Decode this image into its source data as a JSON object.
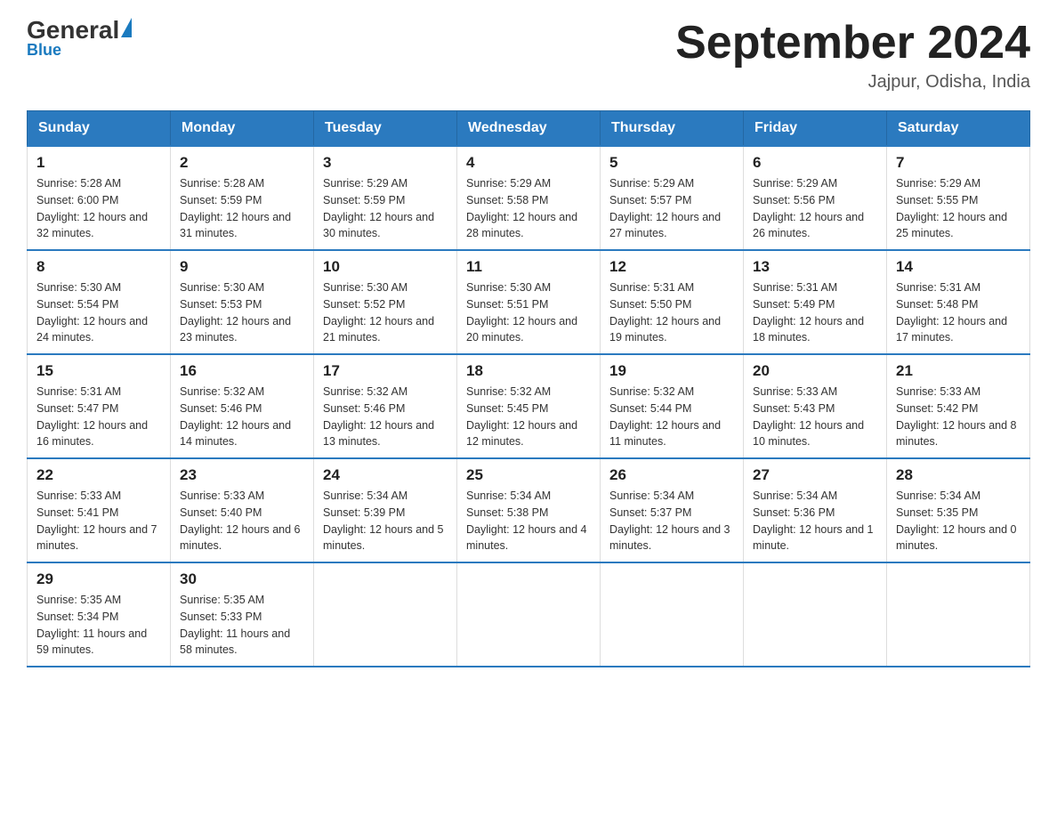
{
  "header": {
    "logo_general": "General",
    "logo_blue": "Blue",
    "month_title": "September 2024",
    "location": "Jajpur, Odisha, India"
  },
  "weekdays": [
    "Sunday",
    "Monday",
    "Tuesday",
    "Wednesday",
    "Thursday",
    "Friday",
    "Saturday"
  ],
  "weeks": [
    [
      {
        "day": "1",
        "sunrise": "5:28 AM",
        "sunset": "6:00 PM",
        "daylight": "12 hours and 32 minutes."
      },
      {
        "day": "2",
        "sunrise": "5:28 AM",
        "sunset": "5:59 PM",
        "daylight": "12 hours and 31 minutes."
      },
      {
        "day": "3",
        "sunrise": "5:29 AM",
        "sunset": "5:59 PM",
        "daylight": "12 hours and 30 minutes."
      },
      {
        "day": "4",
        "sunrise": "5:29 AM",
        "sunset": "5:58 PM",
        "daylight": "12 hours and 28 minutes."
      },
      {
        "day": "5",
        "sunrise": "5:29 AM",
        "sunset": "5:57 PM",
        "daylight": "12 hours and 27 minutes."
      },
      {
        "day": "6",
        "sunrise": "5:29 AM",
        "sunset": "5:56 PM",
        "daylight": "12 hours and 26 minutes."
      },
      {
        "day": "7",
        "sunrise": "5:29 AM",
        "sunset": "5:55 PM",
        "daylight": "12 hours and 25 minutes."
      }
    ],
    [
      {
        "day": "8",
        "sunrise": "5:30 AM",
        "sunset": "5:54 PM",
        "daylight": "12 hours and 24 minutes."
      },
      {
        "day": "9",
        "sunrise": "5:30 AM",
        "sunset": "5:53 PM",
        "daylight": "12 hours and 23 minutes."
      },
      {
        "day": "10",
        "sunrise": "5:30 AM",
        "sunset": "5:52 PM",
        "daylight": "12 hours and 21 minutes."
      },
      {
        "day": "11",
        "sunrise": "5:30 AM",
        "sunset": "5:51 PM",
        "daylight": "12 hours and 20 minutes."
      },
      {
        "day": "12",
        "sunrise": "5:31 AM",
        "sunset": "5:50 PM",
        "daylight": "12 hours and 19 minutes."
      },
      {
        "day": "13",
        "sunrise": "5:31 AM",
        "sunset": "5:49 PM",
        "daylight": "12 hours and 18 minutes."
      },
      {
        "day": "14",
        "sunrise": "5:31 AM",
        "sunset": "5:48 PM",
        "daylight": "12 hours and 17 minutes."
      }
    ],
    [
      {
        "day": "15",
        "sunrise": "5:31 AM",
        "sunset": "5:47 PM",
        "daylight": "12 hours and 16 minutes."
      },
      {
        "day": "16",
        "sunrise": "5:32 AM",
        "sunset": "5:46 PM",
        "daylight": "12 hours and 14 minutes."
      },
      {
        "day": "17",
        "sunrise": "5:32 AM",
        "sunset": "5:46 PM",
        "daylight": "12 hours and 13 minutes."
      },
      {
        "day": "18",
        "sunrise": "5:32 AM",
        "sunset": "5:45 PM",
        "daylight": "12 hours and 12 minutes."
      },
      {
        "day": "19",
        "sunrise": "5:32 AM",
        "sunset": "5:44 PM",
        "daylight": "12 hours and 11 minutes."
      },
      {
        "day": "20",
        "sunrise": "5:33 AM",
        "sunset": "5:43 PM",
        "daylight": "12 hours and 10 minutes."
      },
      {
        "day": "21",
        "sunrise": "5:33 AM",
        "sunset": "5:42 PM",
        "daylight": "12 hours and 8 minutes."
      }
    ],
    [
      {
        "day": "22",
        "sunrise": "5:33 AM",
        "sunset": "5:41 PM",
        "daylight": "12 hours and 7 minutes."
      },
      {
        "day": "23",
        "sunrise": "5:33 AM",
        "sunset": "5:40 PM",
        "daylight": "12 hours and 6 minutes."
      },
      {
        "day": "24",
        "sunrise": "5:34 AM",
        "sunset": "5:39 PM",
        "daylight": "12 hours and 5 minutes."
      },
      {
        "day": "25",
        "sunrise": "5:34 AM",
        "sunset": "5:38 PM",
        "daylight": "12 hours and 4 minutes."
      },
      {
        "day": "26",
        "sunrise": "5:34 AM",
        "sunset": "5:37 PM",
        "daylight": "12 hours and 3 minutes."
      },
      {
        "day": "27",
        "sunrise": "5:34 AM",
        "sunset": "5:36 PM",
        "daylight": "12 hours and 1 minute."
      },
      {
        "day": "28",
        "sunrise": "5:34 AM",
        "sunset": "5:35 PM",
        "daylight": "12 hours and 0 minutes."
      }
    ],
    [
      {
        "day": "29",
        "sunrise": "5:35 AM",
        "sunset": "5:34 PM",
        "daylight": "11 hours and 59 minutes."
      },
      {
        "day": "30",
        "sunrise": "5:35 AM",
        "sunset": "5:33 PM",
        "daylight": "11 hours and 58 minutes."
      },
      null,
      null,
      null,
      null,
      null
    ]
  ]
}
